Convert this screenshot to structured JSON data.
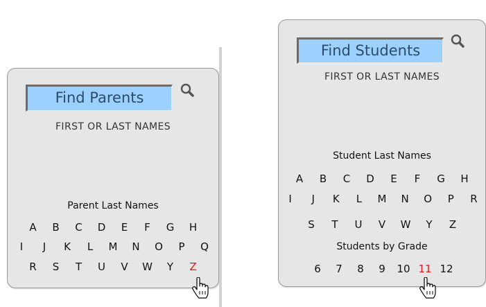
{
  "parents": {
    "search_label": "Find Parents",
    "hint": "FIRST OR LAST NAMES",
    "section_title": "Parent Last Names",
    "letters_row1": [
      "A",
      "B",
      "C",
      "D",
      "E",
      "F",
      "G",
      "H"
    ],
    "letters_row2": [
      "I",
      "J",
      "K",
      "L",
      "M",
      "N",
      "O",
      "P",
      "Q"
    ],
    "letters_row3": [
      "R",
      "S",
      "T",
      "U",
      "V",
      "W",
      "Y",
      "Z"
    ],
    "active_letter": "Z",
    "search_icon": "magnifier-icon"
  },
  "students": {
    "search_label": "Find Students",
    "hint": "FIRST OR LAST NAMES",
    "section_title": "Student Last Names",
    "letters_row1": [
      "A",
      "B",
      "C",
      "D",
      "E",
      "F",
      "G",
      "H"
    ],
    "letters_row2": [
      "I",
      "J",
      "K",
      "L",
      "M",
      "N",
      "O",
      "P",
      "R"
    ],
    "letters_row3": [
      "S",
      "T",
      "U",
      "V",
      "W",
      "Y",
      "Z"
    ],
    "grade_title": "Students by Grade",
    "grades": [
      "6",
      "7",
      "8",
      "9",
      "10",
      "11",
      "12"
    ],
    "active_grade": "11",
    "search_icon": "magnifier-icon"
  },
  "colors": {
    "panel_bg": "#e6e6e6",
    "search_bg": "#9dd1fd",
    "active": "#e01818"
  }
}
